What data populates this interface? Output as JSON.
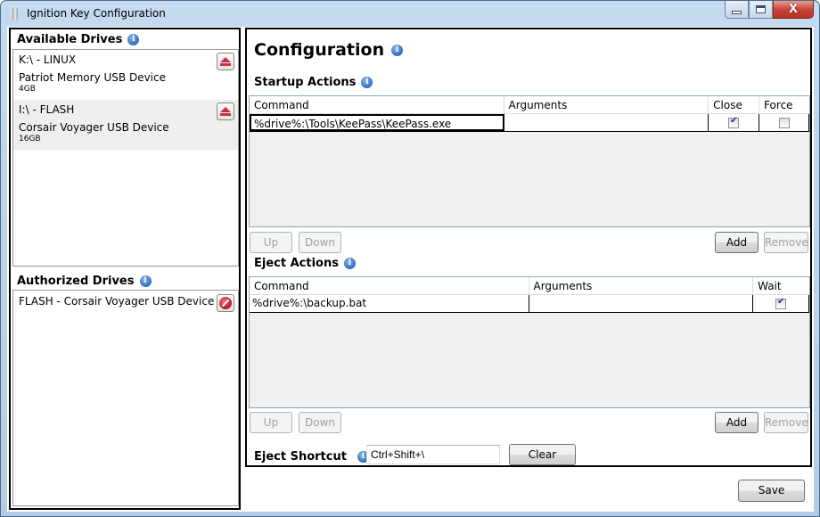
{
  "window": {
    "title": "Ignition Key Configuration",
    "controls": {
      "minimize": "—",
      "maximize": "□",
      "close": "X"
    }
  },
  "available_drives": {
    "title": "Available Drives",
    "items": [
      {
        "label": "K:\\ - LINUX",
        "device": "Patriot Memory USB Device",
        "size": "4GB",
        "action_icon": "eject-icon"
      },
      {
        "label": "I:\\ - FLASH",
        "device": "Corsair Voyager USB Device",
        "size": "16GB",
        "action_icon": "eject-icon"
      }
    ]
  },
  "authorized_drives": {
    "title": "Authorized Drives",
    "items": [
      {
        "label": "FLASH - Corsair Voyager USB Device",
        "action_icon": "block-icon"
      }
    ]
  },
  "configuration": {
    "title": "Configuration",
    "startup_actions": {
      "title": "Startup Actions",
      "columns": [
        "Command",
        "Arguments",
        "Close",
        "Force"
      ],
      "rows": [
        {
          "command": "%drive%:\\Tools\\KeePass\\KeePass.exe",
          "arguments": "",
          "close": true,
          "force": false
        }
      ],
      "buttons": {
        "up": "Up",
        "down": "Down",
        "add": "Add",
        "remove": "Remove"
      }
    },
    "eject_actions": {
      "title": "Eject Actions",
      "columns": [
        "Command",
        "Arguments",
        "Wait"
      ],
      "rows": [
        {
          "command": "%drive%:\\backup.bat",
          "arguments": "",
          "wait": true
        }
      ],
      "buttons": {
        "up": "Up",
        "down": "Down",
        "add": "Add",
        "remove": "Remove"
      }
    },
    "eject_shortcut": {
      "label": "Eject Shortcut",
      "value": "Ctrl+Shift+\\",
      "clear_label": "Clear"
    }
  },
  "footer": {
    "save_label": "Save"
  }
}
